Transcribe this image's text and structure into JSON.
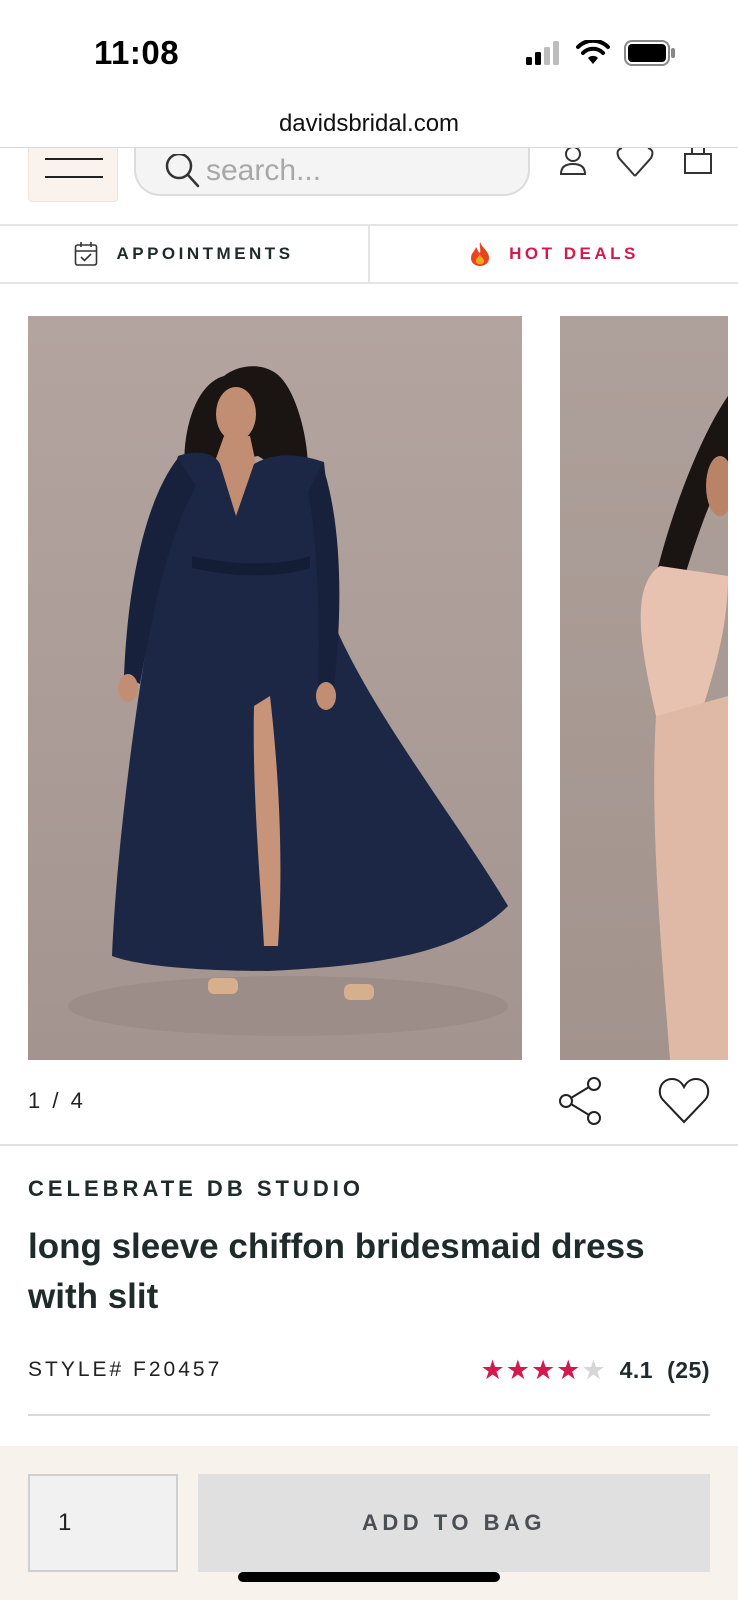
{
  "status_bar": {
    "time": "11:08",
    "icons": [
      "signal-icon",
      "wifi-icon",
      "battery-icon"
    ]
  },
  "browser": {
    "url": "davidsbridal.com"
  },
  "header": {
    "search_placeholder": "search...",
    "icons": [
      "menu-icon",
      "search-icon",
      "account-icon",
      "wishlist-icon",
      "bag-icon"
    ]
  },
  "quick_links": {
    "appointments": "APPOINTMENTS",
    "hot_deals": "HOT DEALS"
  },
  "gallery": {
    "counter": "1 / 4",
    "current": 1,
    "total": 4,
    "main_dress_color": "#1c2745",
    "next_dress_color": "#e8c2b0"
  },
  "product": {
    "brand": "CELEBRATE DB STUDIO",
    "title": "long sleeve chiffon bridesmaid dress with slit",
    "style": "STYLE# F20457",
    "rating_value": 4.1,
    "rating_display": "4.1",
    "review_count": "(25)",
    "stars_filled": 4,
    "stars_total": 5
  },
  "purchase": {
    "quantity": "1",
    "add_to_bag_label": "ADD TO BAG"
  },
  "colors": {
    "accent_pink": "#d4194e",
    "text_dark": "#1f2a2a",
    "bottom_bar_bg": "#f8f2ed",
    "button_disabled_bg": "#e0e0e0"
  }
}
